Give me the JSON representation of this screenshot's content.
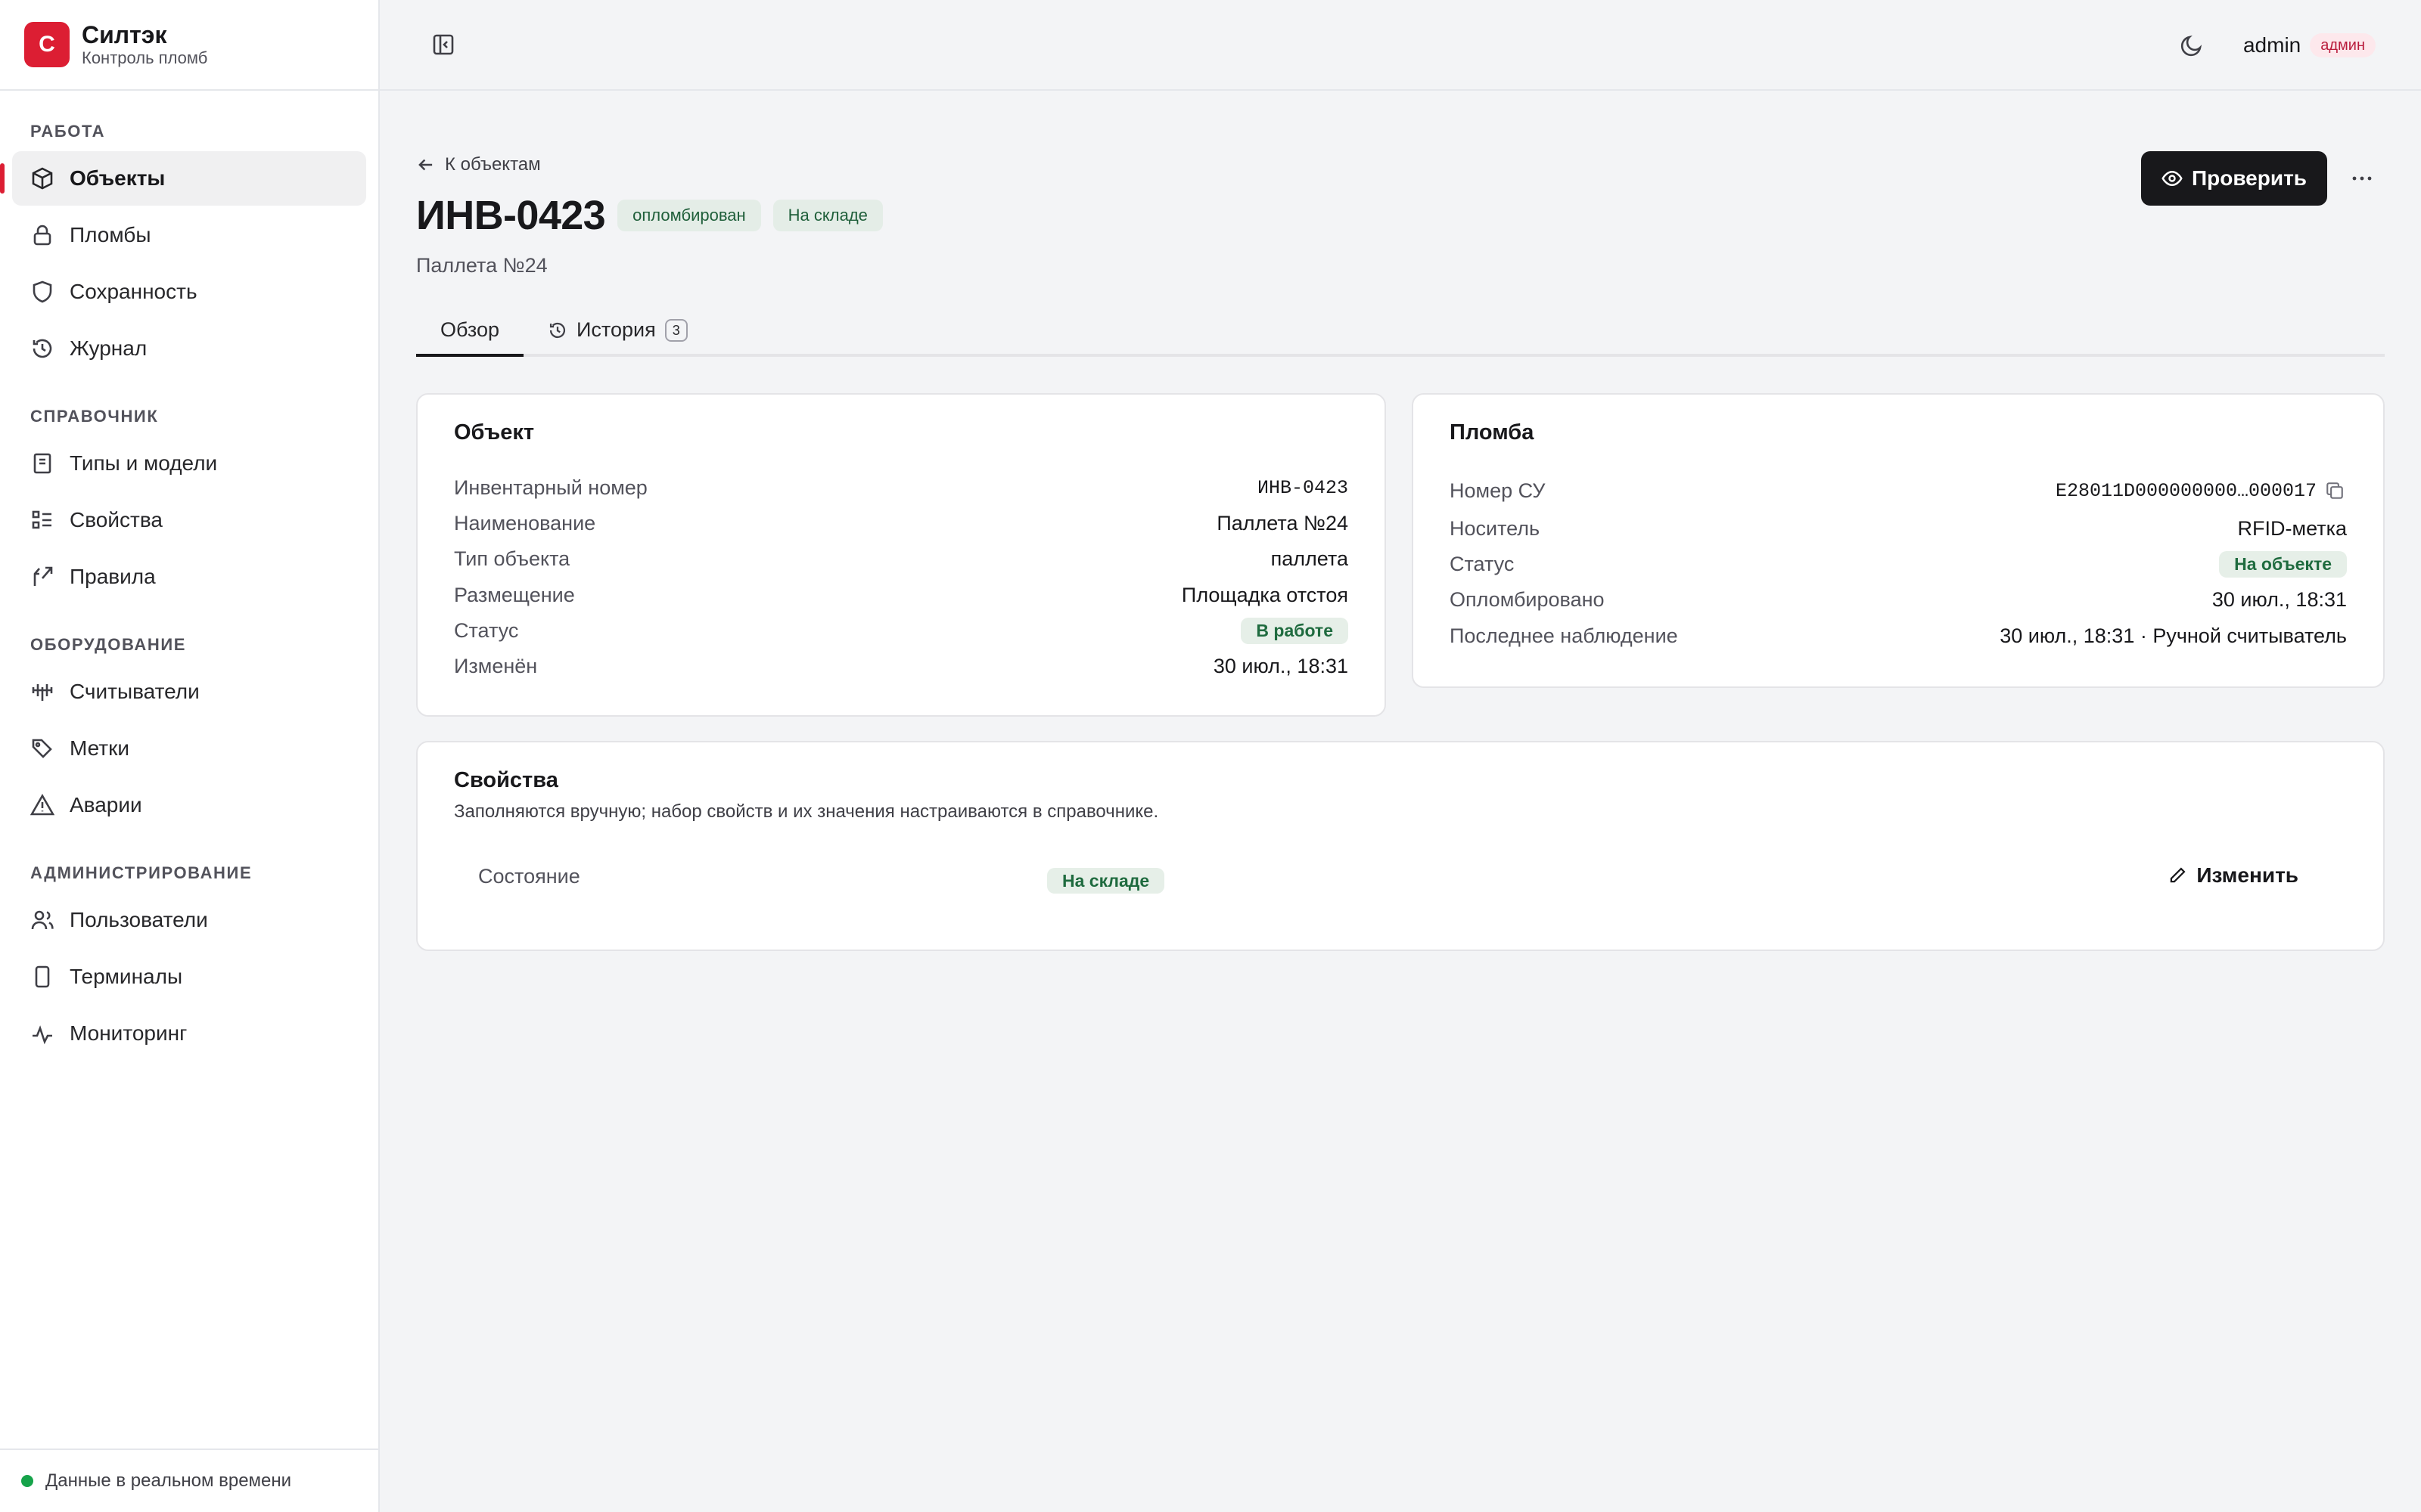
{
  "brand": {
    "logo_letter": "С",
    "name": "Силтэк",
    "subtitle": "Контроль пломб",
    "accent": "#dc1e33"
  },
  "sidebar": {
    "sections": [
      {
        "heading": "РАБОТА",
        "items": [
          {
            "label": "Объекты",
            "icon": "box-icon",
            "active": true
          },
          {
            "label": "Пломбы",
            "icon": "lock-icon"
          },
          {
            "label": "Сохранность",
            "icon": "shield-icon"
          },
          {
            "label": "Журнал",
            "icon": "history-icon"
          }
        ]
      },
      {
        "heading": "СПРАВОЧНИК",
        "items": [
          {
            "label": "Типы и модели",
            "icon": "book-icon"
          },
          {
            "label": "Свойства",
            "icon": "list-icon"
          },
          {
            "label": "Правила",
            "icon": "branch-icon"
          }
        ]
      },
      {
        "heading": "ОБОРУДОВАНИЕ",
        "items": [
          {
            "label": "Считыватели",
            "icon": "antenna-icon"
          },
          {
            "label": "Метки",
            "icon": "tags-icon"
          },
          {
            "label": "Аварии",
            "icon": "warning-icon"
          }
        ]
      },
      {
        "heading": "АДМИНИСТРИРОВАНИЕ",
        "items": [
          {
            "label": "Пользователи",
            "icon": "users-icon"
          },
          {
            "label": "Терминалы",
            "icon": "device-icon"
          },
          {
            "label": "Мониторинг",
            "icon": "pulse-icon"
          }
        ]
      }
    ],
    "footer": "Данные в реальном времени"
  },
  "topbar": {
    "user": "admin",
    "role": "админ"
  },
  "page": {
    "back": "К объектам",
    "title": "ИНВ-0423",
    "badges": [
      "опломбирован",
      "На складе"
    ],
    "subtitle": "Паллета №24",
    "check_button": "Проверить",
    "tabs": [
      {
        "label": "Обзор"
      },
      {
        "label": "История",
        "count": "3"
      }
    ]
  },
  "object_card": {
    "title": "Объект",
    "rows": [
      {
        "k": "Инвентарный номер",
        "v": "ИНВ-0423"
      },
      {
        "k": "Наименование",
        "v": "Паллета №24"
      },
      {
        "k": "Тип объекта",
        "v": "паллета"
      },
      {
        "k": "Размещение",
        "v": "Площадка отстоя"
      },
      {
        "k": "Статус",
        "v": "В работе"
      },
      {
        "k": "Изменён",
        "v": "30 июл., 18:31"
      }
    ]
  },
  "seal_card": {
    "title": "Пломба",
    "rows": [
      {
        "k": "Номер СУ",
        "v": "E28011D000000000…000017"
      },
      {
        "k": "Носитель",
        "v": "RFID-метка"
      },
      {
        "k": "Статус",
        "v": "На объекте"
      },
      {
        "k": "Опломбировано",
        "v": "30 июл., 18:31"
      },
      {
        "k": "Последнее наблюдение",
        "v": "30 июл., 18:31 · Ручной считыватель"
      }
    ]
  },
  "props_card": {
    "title": "Свойства",
    "description": "Заполняются вручную; набор свойств и их значения настраиваются в справочнике.",
    "rows": [
      {
        "k": "Состояние",
        "v": "На складе"
      }
    ],
    "edit_label": "Изменить"
  }
}
